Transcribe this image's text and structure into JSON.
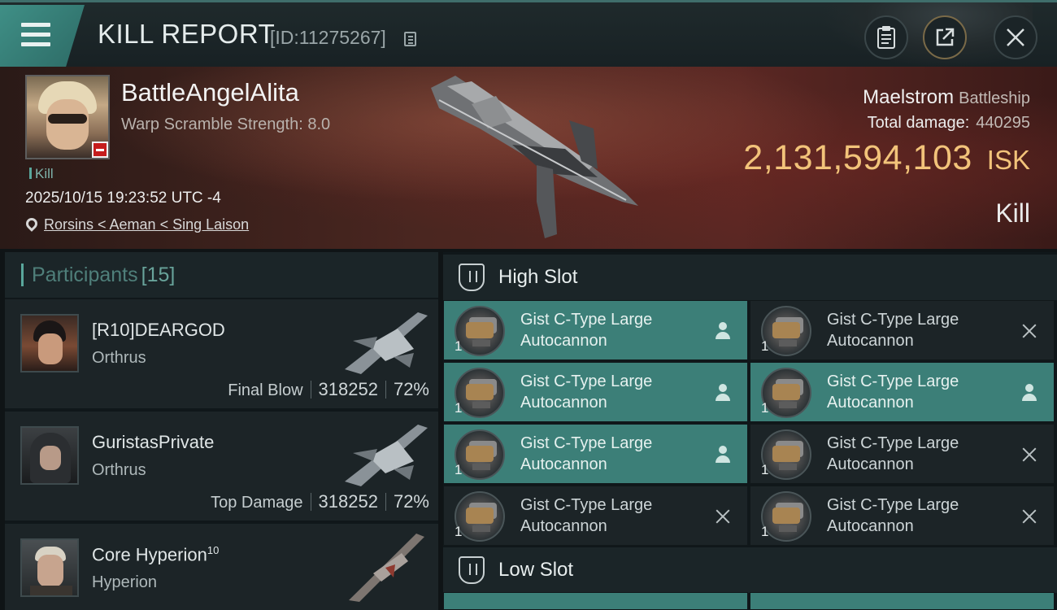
{
  "header": {
    "title": "KILL REPORT",
    "report_id": "[ID:11275267]"
  },
  "victim": {
    "name": "BattleAngelAlita",
    "scramble": "Warp Scramble Strength: 8.0",
    "kill_tag": "Kill",
    "datetime": "2025/10/15 19:23:52 UTC -4",
    "location": "Rorsins < Aeman < Sing Laison",
    "ship_name": "Maelstrom",
    "ship_class": "Battleship",
    "total_damage_label": "Total damage:",
    "total_damage": "440295",
    "isk_value": "2,131,594,103",
    "isk_unit": "ISK",
    "result": "Kill"
  },
  "participants": {
    "label": "Participants",
    "count": "[15]",
    "rows": [
      {
        "name": "[R10]DEARGOD",
        "sup": "",
        "ship": "Orthrus",
        "role": "Final Blow",
        "damage": "318252",
        "percent": "72%"
      },
      {
        "name": "GuristasPrivate",
        "sup": "",
        "ship": "Orthrus",
        "role": "Top Damage",
        "damage": "318252",
        "percent": "72%"
      },
      {
        "name": "Core Hyperion",
        "sup": "10",
        "ship": "Hyperion",
        "role": "",
        "damage": "",
        "percent": ""
      }
    ]
  },
  "fittings": {
    "high_slot_label": "High Slot",
    "low_slot_label": "Low Slot",
    "high_slot": [
      {
        "name": "Gist C-Type Large Autocannon",
        "qty": "1",
        "status": "pilot",
        "active": true
      },
      {
        "name": "Gist C-Type Large Autocannon",
        "qty": "1",
        "status": "destroyed",
        "active": false
      },
      {
        "name": "Gist C-Type Large Autocannon",
        "qty": "1",
        "status": "pilot",
        "active": true
      },
      {
        "name": "Gist C-Type Large Autocannon",
        "qty": "1",
        "status": "pilot",
        "active": true
      },
      {
        "name": "Gist C-Type Large Autocannon",
        "qty": "1",
        "status": "pilot",
        "active": true
      },
      {
        "name": "Gist C-Type Large Autocannon",
        "qty": "1",
        "status": "destroyed",
        "active": false
      },
      {
        "name": "Gist C-Type Large Autocannon",
        "qty": "1",
        "status": "destroyed",
        "active": false
      },
      {
        "name": "Gist C-Type Large Autocannon",
        "qty": "1",
        "status": "destroyed",
        "active": false
      }
    ]
  },
  "colors": {
    "accent": "#3c7f78",
    "isk": "#f2c37a",
    "background": "#10171a"
  }
}
